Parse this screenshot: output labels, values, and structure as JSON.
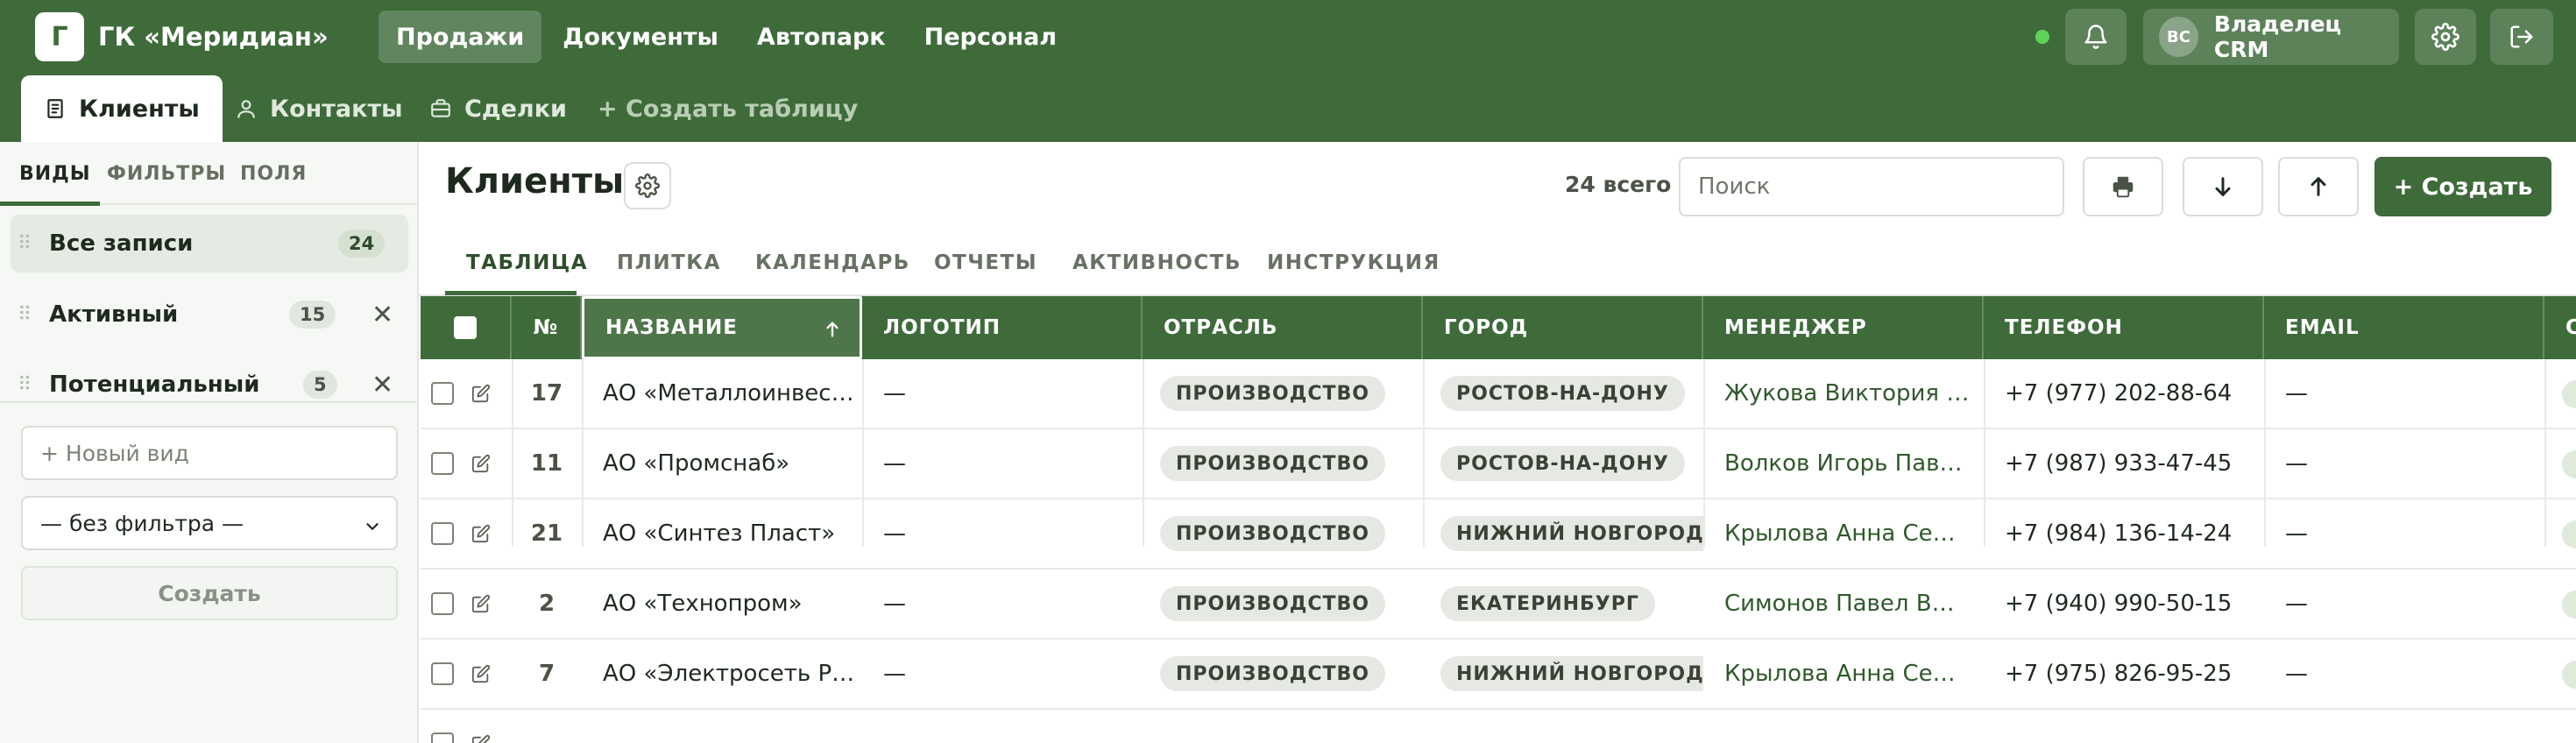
{
  "app": {
    "logo_letter": "Г",
    "brand": "ГК «Меридиан»",
    "nav": [
      "Продажи",
      "Документы",
      "Автопарк",
      "Персонал"
    ],
    "user_initials": "ВС",
    "user_name": "Владелец CRM",
    "status": "online"
  },
  "tables_bar": {
    "tabs": [
      "Клиенты",
      "Контакты",
      "Сделки"
    ],
    "create_table": "+ Создать таблицу"
  },
  "sidebar": {
    "tabs": [
      "ВИДЫ",
      "ФИЛЬТРЫ",
      "ПОЛЯ"
    ],
    "views": [
      {
        "label": "Все записи",
        "count": "24"
      },
      {
        "label": "Активный",
        "count": "15"
      },
      {
        "label": "Потенциальный",
        "count": "5"
      }
    ],
    "new_view_placeholder": "+ Новый вид",
    "filter_select": "— без фильтра —",
    "create_label": "Создать"
  },
  "main": {
    "title": "Клиенты",
    "total": "24 всего",
    "search_placeholder": "Поиск",
    "create_button": "+ Создать",
    "view_tabs": [
      "ТАБЛИЦА",
      "ПЛИТКА",
      "КАЛЕНДАРЬ",
      "ОТЧЕТЫ",
      "АКТИВНОСТЬ",
      "ИНСТРУКЦИЯ"
    ]
  },
  "table": {
    "columns": [
      "№",
      "НАЗВАНИЕ",
      "ЛОГОТИП",
      "ОТРАСЛЬ",
      "ГОРОД",
      "МЕНЕДЖЕР",
      "ТЕЛЕФОН",
      "EMAIL",
      "С"
    ],
    "rows": [
      {
        "num": "17",
        "name": "АО «Металлоинвес…",
        "logo": "—",
        "industry": "ПРОИЗВОДСТВО",
        "city": "РОСТОВ-НА-ДОНУ",
        "manager": "Жукова Виктория …",
        "phone": "+7 (977) 202-88-64",
        "email": "—"
      },
      {
        "num": "11",
        "name": "АО «Промснаб»",
        "logo": "—",
        "industry": "ПРОИЗВОДСТВО",
        "city": "РОСТОВ-НА-ДОНУ",
        "manager": "Волков Игорь Пав…",
        "phone": "+7 (987) 933-47-45",
        "email": "—"
      },
      {
        "num": "21",
        "name": "АО «Синтез Пласт»",
        "logo": "—",
        "industry": "ПРОИЗВОДСТВО",
        "city": "НИЖНИЙ НОВГОРОД",
        "manager": "Крылова Анна Се…",
        "phone": "+7 (984) 136-14-24",
        "email": "—"
      },
      {
        "num": "2",
        "name": "АО «Технопром»",
        "logo": "—",
        "industry": "ПРОИЗВОДСТВО",
        "city": "ЕКАТЕРИНБУРГ",
        "manager": "Симонов Павел В…",
        "phone": "+7 (940) 990-50-15",
        "email": "—"
      },
      {
        "num": "7",
        "name": "АО «Электросеть Р…",
        "logo": "—",
        "industry": "ПРОИЗВОДСТВО",
        "city": "НИЖНИЙ НОВГОРОД",
        "manager": "Крылова Анна Се…",
        "phone": "+7 (975) 826-95-25",
        "email": "—"
      },
      {
        "num": "",
        "name": "",
        "logo": "",
        "industry": "",
        "city": "",
        "manager": "",
        "phone": "",
        "email": ""
      }
    ]
  },
  "colors": {
    "brand_green": "#3f6b3b",
    "status_dot": "#5ed35a",
    "badge_bg": "#e6e8e4"
  }
}
